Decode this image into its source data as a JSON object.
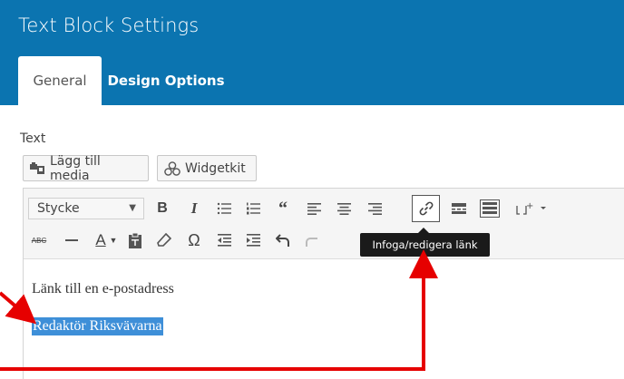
{
  "dialog": {
    "title": "Text Block Settings"
  },
  "tabs": [
    {
      "label": "General",
      "active": true
    },
    {
      "label": "Design Options",
      "active": false
    }
  ],
  "field": {
    "label": "Text",
    "buttons": [
      {
        "label": "Lägg till media",
        "icon": "media-icon"
      },
      {
        "label": "Widgetkit",
        "icon": "widgetkit-icon"
      }
    ]
  },
  "toolbar": {
    "format": "Stycke",
    "row1_icons": [
      "bold-icon",
      "italic-icon",
      "bullet-list-icon",
      "numbered-list-icon",
      "blockquote-icon",
      "align-left-icon",
      "align-center-icon",
      "align-right-icon",
      "link-icon",
      "read-more-icon",
      "toolbar-toggle-icon",
      "shortcode-icon"
    ],
    "row2_icons": [
      "strikethrough-icon",
      "horizontal-line-icon",
      "text-color-icon",
      "paste-text-icon",
      "clear-formatting-icon",
      "special-character-icon",
      "outdent-icon",
      "indent-icon",
      "undo-icon",
      "redo-icon",
      "help-icon"
    ],
    "bold": "B",
    "italic": "I",
    "omega": "Ω",
    "strike": "ABC",
    "textcolor": "A"
  },
  "tooltip": "Infoga/redigera länk",
  "content": {
    "line1": "Länk till en e-postadress",
    "line2": "Redaktör Riksvävarna"
  },
  "colors": {
    "header": "#0b74b0",
    "selection": "#3e8fd8",
    "annotation": "#e60000"
  }
}
